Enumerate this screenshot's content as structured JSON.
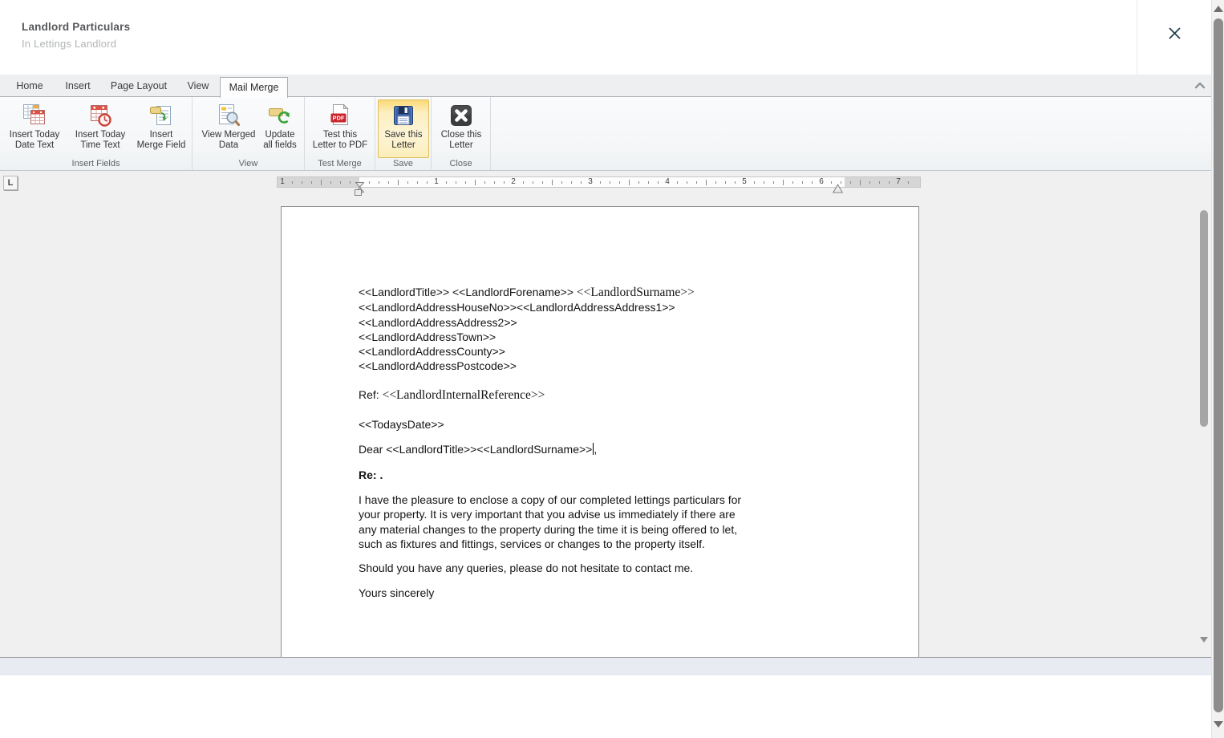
{
  "header": {
    "title": "Landlord Particulars",
    "subtitle": "In Lettings Landlord"
  },
  "tabs": {
    "items": [
      {
        "label": "Home"
      },
      {
        "label": "Insert"
      },
      {
        "label": "Page Layout"
      },
      {
        "label": "View"
      },
      {
        "label": "Mail Merge"
      }
    ]
  },
  "ribbon": {
    "pdf_badge": "PDF",
    "groups": [
      {
        "label": "Insert Fields",
        "buttons": [
          {
            "line1": "Insert Today",
            "line2": "Date Text",
            "icon": "calendar-date-icon"
          },
          {
            "line1": "Insert Today",
            "line2": "Time Text",
            "icon": "calendar-clock-icon"
          },
          {
            "line1": "Insert",
            "line2": "Merge Field",
            "icon": "merge-field-icon"
          }
        ]
      },
      {
        "label": "View",
        "buttons": [
          {
            "line1": "View Merged",
            "line2": "Data",
            "icon": "view-merged-data-icon"
          },
          {
            "line1": "Update",
            "line2": "all fields",
            "icon": "update-fields-icon"
          }
        ]
      },
      {
        "label": "Test Merge",
        "buttons": [
          {
            "line1": "Test this",
            "line2": "Letter to PDF",
            "icon": "pdf-icon"
          }
        ]
      },
      {
        "label": "Save",
        "buttons": [
          {
            "line1": "Save this",
            "line2": "Letter",
            "icon": "save-icon",
            "highlighted": true
          }
        ]
      },
      {
        "label": "Close",
        "buttons": [
          {
            "line1": "Close this",
            "line2": "Letter",
            "icon": "close-letter-icon"
          }
        ]
      }
    ]
  },
  "ruler": {
    "tab_selector": "L",
    "numbers": [
      "1",
      "",
      "1",
      "2",
      "3",
      "4",
      "5",
      "6",
      "7"
    ]
  },
  "document": {
    "address_line1_sans": "<<LandlordTitle>> <<LandlordForename>> ",
    "address_line1_serif": "<<LandlordSurname>>",
    "address_lines": [
      "<<LandlordAddressHouseNo>><<LandlordAddressAddress1>>",
      "<<LandlordAddressAddress2>>",
      "<<LandlordAddressTown>>",
      "<<LandlordAddressCounty>>",
      "<<LandlordAddressPostcode>>"
    ],
    "ref_label": "Ref: ",
    "ref_field": "<<LandlordInternalReference>>",
    "date_field": "<<TodaysDate>>",
    "salutation": "Dear <<LandlordTitle>><<LandlordSurname>>",
    "salutation_tail": ",",
    "subject": "Re: .",
    "paragraph1_lines": [
      "I have the pleasure to enclose a copy of our completed lettings particulars for",
      "your property. It is very important that you advise us immediately if there are",
      "any material changes to the property during the time it is being offered to let,",
      "such as fixtures and fittings, services or changes to the property itself."
    ],
    "paragraph2": "Should you have any queries, please do not hesitate to contact me.",
    "closing": "Yours sincerely"
  },
  "colors": {
    "save_highlight_border": "#dfbe62",
    "save_highlight_bg": "#fdf4d6",
    "pdf_red": "#c9262c",
    "editor_bg": "#f0f0f0",
    "band_bg": "#e8ecf2",
    "tab_row_bg": "#edeff1",
    "close_x": "#24424f"
  }
}
